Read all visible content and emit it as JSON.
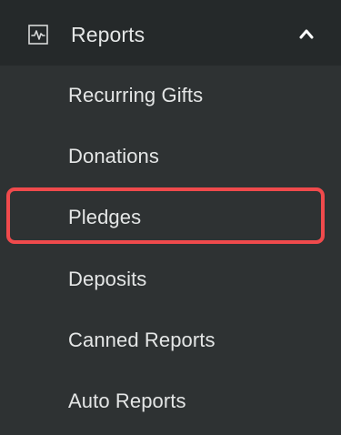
{
  "menu": {
    "header": {
      "label": "Reports",
      "icon": "activity-chart-icon",
      "toggle_icon": "chevron-up-icon"
    },
    "items": [
      {
        "label": "Recurring Gifts"
      },
      {
        "label": "Donations"
      },
      {
        "label": "Pledges"
      },
      {
        "label": "Deposits",
        "highlighted": true
      },
      {
        "label": "Canned Reports"
      },
      {
        "label": "Auto Reports"
      }
    ]
  },
  "colors": {
    "background": "#2e3233",
    "header_background": "#25292a",
    "text": "#e4e6e6",
    "highlight_border": "#f04a4c"
  }
}
